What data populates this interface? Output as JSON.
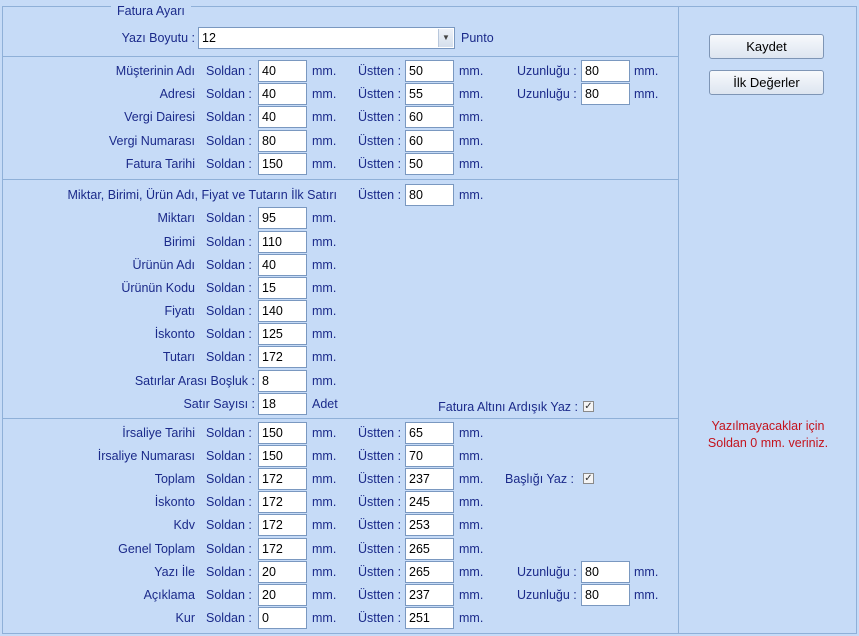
{
  "fieldset_title": "Fatura Ayarı",
  "font_row": {
    "label": "Yazı Boyutu :",
    "value": "12",
    "unit": "Punto"
  },
  "units": {
    "mm": "mm.",
    "adet": "Adet"
  },
  "col_labels": {
    "soldan": "Soldan :",
    "ustten": "Üstten :",
    "uzunlugu": "Uzunluğu :"
  },
  "header_rows": [
    {
      "label": "Müşterinin Adı",
      "soldan": "40",
      "ustten": "50",
      "uzunlugu": "80"
    },
    {
      "label": "Adresi",
      "soldan": "40",
      "ustten": "55",
      "uzunlugu": "80"
    },
    {
      "label": "Vergi Dairesi",
      "soldan": "40",
      "ustten": "60"
    },
    {
      "label": "Vergi Numarası",
      "soldan": "80",
      "ustten": "60"
    },
    {
      "label": "Fatura Tarihi",
      "soldan": "150",
      "ustten": "50"
    }
  ],
  "item_section": {
    "first_row_label": "Miktar, Birimi, Ürün Adı, Fiyat ve Tutarın İlk Satırı",
    "first_row_ustten": "80",
    "rows": [
      {
        "label": "Miktarı",
        "soldan": "95"
      },
      {
        "label": "Birimi",
        "soldan": "110"
      },
      {
        "label": "Ürünün Adı",
        "soldan": "40"
      },
      {
        "label": "Ürünün Kodu",
        "soldan": "15"
      },
      {
        "label": "Fiyatı",
        "soldan": "140"
      },
      {
        "label": "İskonto",
        "soldan": "125"
      },
      {
        "label": "Tutarı",
        "soldan": "172"
      }
    ],
    "line_spacing": {
      "label": "Satırlar Arası Boşluk :",
      "value": "8"
    },
    "row_count": {
      "label": "Satır Sayısı :",
      "value": "18"
    },
    "consecutive": {
      "label": "Fatura Altını Ardışık Yaz :",
      "checked": true
    }
  },
  "footer_rows": [
    {
      "label": "İrsaliye Tarihi",
      "soldan": "150",
      "ustten": "65"
    },
    {
      "label": "İrsaliye Numarası",
      "soldan": "150",
      "ustten": "70"
    },
    {
      "label": "Toplam",
      "soldan": "172",
      "ustten": "237"
    },
    {
      "label": "İskonto",
      "soldan": "172",
      "ustten": "245"
    },
    {
      "label": "Kdv",
      "soldan": "172",
      "ustten": "253"
    },
    {
      "label": "Genel Toplam",
      "soldan": "172",
      "ustten": "265"
    },
    {
      "label": "Yazı İle",
      "soldan": "20",
      "ustten": "265",
      "uzunlugu": "80"
    },
    {
      "label": "Açıklama",
      "soldan": "20",
      "ustten": "237",
      "uzunlugu": "80"
    },
    {
      "label": "Kur",
      "soldan": "0",
      "ustten": "251"
    }
  ],
  "title_checkbox": {
    "label": "Başlığı Yaz :",
    "checked": true
  },
  "buttons": {
    "save": "Kaydet",
    "defaults": "İlk Değerler"
  },
  "warning": {
    "line1": "Yazılmayacaklar için",
    "line2": "Soldan 0 mm. veriniz."
  },
  "colors": {
    "background": "#c6dbf7",
    "label": "#1b2a8a",
    "warning": "#c4131d"
  }
}
